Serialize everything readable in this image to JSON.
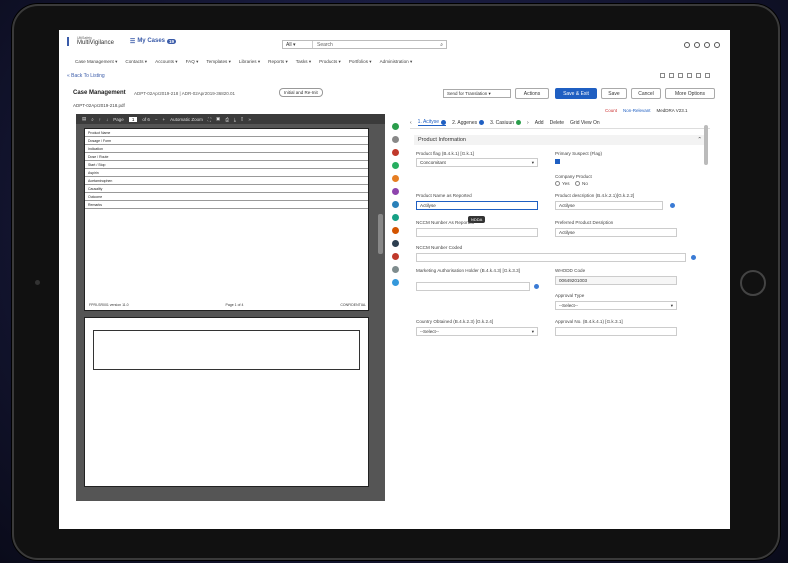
{
  "app": {
    "brand_small": "UltiSafety",
    "brand": "MultiVigilance",
    "my_cases": "My Cases",
    "my_cases_count": "19"
  },
  "search": {
    "scope": "All",
    "placeholder": "Search"
  },
  "nav": [
    "Case Management ▾",
    "Contacts ▾",
    "Accounts ▾",
    "FAQ ▾",
    "Templates ▾",
    "Libraries ▾",
    "Reports ▾",
    "Tasks ▾",
    "Products ▾",
    "Portfolios ▾",
    "Administration ▾"
  ],
  "back_label": "« Back To Listing",
  "case": {
    "title": "Case Management",
    "ids": "ADPT-02Apr2019-218 | ADR-02Apr2019-36820.01",
    "status_chip": "Initial and Re-Init",
    "send_label": "Send for Translation",
    "buttons": {
      "actions": "Actions",
      "save_exit": "Save & Exit",
      "save": "Save",
      "cancel": "Cancel",
      "more": "More Options"
    },
    "file": "ADPT-02Apr2019-218.pdf",
    "sub_links": {
      "count": "Count",
      "non_relevant": "Non-Relevant",
      "meddra": "MedDRA V23.1"
    }
  },
  "pdf": {
    "page_label": "Page",
    "page_num": "1",
    "page_total": "of 6",
    "zoom": "Automatic Zoom",
    "page_footer_left": "FPRI-SR001 version 11.0",
    "page_footer_mid": "Page 1 of 4",
    "page_footer_right": "CONFIDENTIAL",
    "rows": [
      "Product Name",
      "Dosage / Form",
      "Indication",
      "Dose / Route",
      "Start / Stop",
      "Aspirin",
      "Acetaminophen",
      "Causality",
      "Outcome",
      "Remarks"
    ]
  },
  "tabs": [
    {
      "label": "1. Acityse",
      "active": true
    },
    {
      "label": "2. Aggenes",
      "active": false
    },
    {
      "label": "3. Casiuun",
      "active": false
    }
  ],
  "tab_actions": {
    "add": "Add",
    "delete": "Delete",
    "grid": "Grid View On"
  },
  "product_info": {
    "section": "Product Information",
    "product_flag_label": "Product flag (B.4.k.1) [G.k.1]",
    "product_flag_value": "Concomitant",
    "primary_suspect_label": "Primary Suspect (Flag)",
    "company_product_label": "Company Product",
    "yes": "Yes",
    "no": "No",
    "name_as_reported_label": "Product Name as Reported",
    "name_as_reported_value": "Actilyse",
    "product_desc_label": "Product description (B.4.k.2.1)[G.k.2.2]",
    "product_desc_value": "Actilyse",
    "tooltip": "NDDA",
    "nccm_label": "NCCM Number As Reported",
    "preferred_label": "Preferred Product Desription",
    "preferred_value": "Actilyse",
    "nccm_coded_label": "NCCM Number Coded",
    "mah_label": "Marketing Authorisation Holder (B.4.k.4.3) [G.k.3.3]",
    "whodd_label": "WHODD Code",
    "whodd_value": "00649201003",
    "approval_type_label": "Approval Type",
    "approval_type_value": "--Select--",
    "country_label": "Country Obtained (B.4.k.2.3) [G.k.2.4]",
    "country_value": "--Select--",
    "approval_no_label": "Approval No. (B.4.k.4.1) [G.k.3.1]"
  },
  "colors": {
    "primary": "#1f5fc2",
    "brand": "#3a5ba9"
  }
}
